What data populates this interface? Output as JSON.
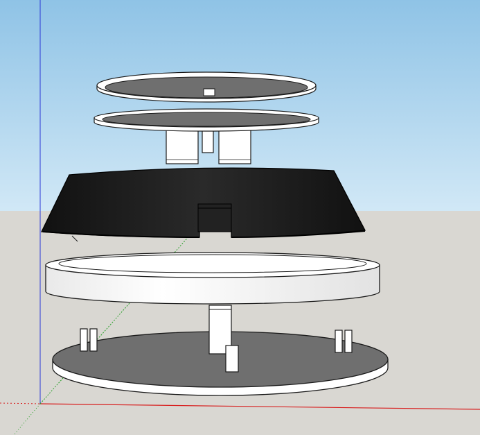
{
  "app": {
    "view": "3d-model-viewport"
  },
  "colors": {
    "sky_top": "#8fc3e6",
    "sky_bottom": "#cde4f4",
    "ground": "#d9d7d2",
    "part_white": "#ffffff",
    "part_gray": "#6f6f6f",
    "part_dark": "#1b1b1b",
    "edge": "#1a1a1a",
    "axis_red": "#d81f1f",
    "axis_green": "#2ca12c",
    "axis_blue": "#2c39d6"
  },
  "model": {
    "parts": [
      "top-disc",
      "second-disc",
      "connector-block-left",
      "connector-block-center",
      "connector-block-right",
      "black-shade",
      "white-ring",
      "center-post",
      "base-plate",
      "peg-pair-left",
      "peg-pair-right",
      "front-peg"
    ]
  }
}
